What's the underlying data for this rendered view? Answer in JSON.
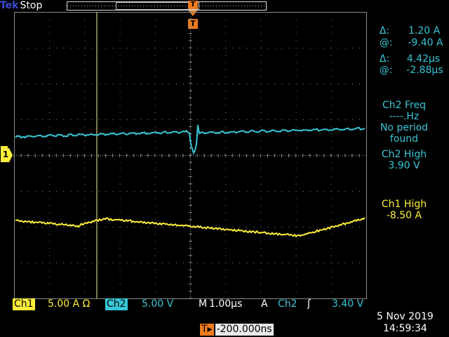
{
  "header": {
    "brand": "Tek",
    "run_state": "Stop",
    "trigger_marker": "T"
  },
  "cursor_readouts": {
    "amp_delta": "1.20 A",
    "amp_at": "-9.40 A",
    "time_delta": "4.42µs",
    "time_at": "-2.88µs",
    "delta_symbol": "Δ:",
    "at_symbol": "@:"
  },
  "measurements": [
    {
      "label": "Ch2 Freq",
      "value": "----.Hz",
      "note1": "No period",
      "note2": "found"
    },
    {
      "label": "Ch2 High",
      "value": "3.90 V"
    },
    {
      "label": "Ch1 High",
      "value": "-8.50 A"
    }
  ],
  "channel_marker": "1",
  "settings": {
    "ch1_label": "Ch1",
    "ch1_scale": "5.00 A Ω",
    "ch2_label": "Ch2",
    "ch2_scale": "5.00 V",
    "timebase_prefix": "M",
    "timebase": "1.00µs",
    "trigger_mode": "A",
    "trigger_source": "Ch2",
    "trigger_slope": "ʃ",
    "trigger_level": "3.40 V"
  },
  "trigger_position": {
    "icon": "T▸",
    "value": "-200.000ns"
  },
  "datetime": {
    "date": "5 Nov 2019",
    "time": "14:59:34"
  },
  "colors": {
    "ch1": "#ffee3a",
    "ch2": "#37c6d6",
    "trigger": "#f07a1a",
    "grid": "#8a8a8a",
    "cursor": "#f4f0a0"
  }
}
